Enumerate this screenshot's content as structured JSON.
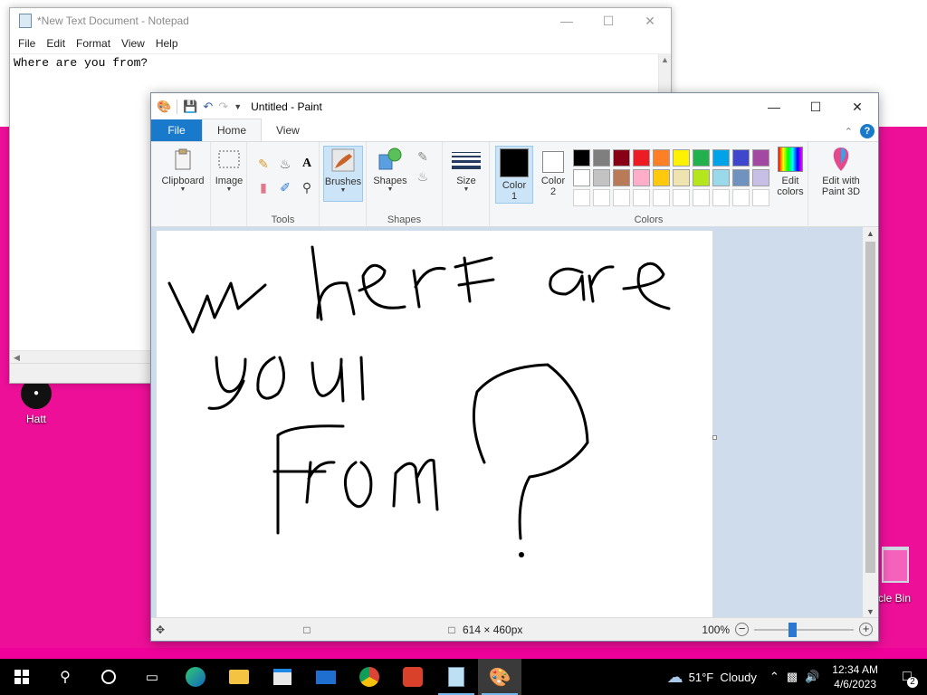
{
  "desktop": {
    "icons": [
      {
        "label": "Hatt"
      },
      {
        "label": "cle Bin"
      }
    ]
  },
  "notepad": {
    "title": "*New Text Document - Notepad",
    "menu": [
      "File",
      "Edit",
      "Format",
      "View",
      "Help"
    ],
    "content": "Where are you from?"
  },
  "paint": {
    "title": "Untitled - Paint",
    "tabs": {
      "file": "File",
      "home": "Home",
      "view": "View"
    },
    "ribbon": {
      "clipboard": "Clipboard",
      "image": "Image",
      "tools": "Tools",
      "brushes": "Brushes",
      "shapes": "Shapes",
      "shapes_group": "Shapes",
      "size": "Size",
      "color1": "Color\n1",
      "color1_a": "Color",
      "color1_b": "1",
      "color2_a": "Color",
      "color2_b": "2",
      "colors": "Colors",
      "edit_colors_a": "Edit",
      "edit_colors_b": "colors",
      "paint3d_a": "Edit with",
      "paint3d_b": "Paint 3D"
    },
    "palette_row1": [
      "#000000",
      "#7f7f7f",
      "#880015",
      "#ed1c24",
      "#ff7f27",
      "#fff200",
      "#22b14c",
      "#00a2e8",
      "#3f48cc",
      "#a349a4"
    ],
    "palette_row2": [
      "#ffffff",
      "#c3c3c3",
      "#b97a57",
      "#ffaec9",
      "#ffc90e",
      "#efe4b0",
      "#b5e61d",
      "#99d9ea",
      "#7092be",
      "#c8bfe7"
    ],
    "color1": "#000000",
    "color2": "#ffffff",
    "canvas_size": "614 × 460px",
    "zoom": "100%"
  },
  "taskbar": {
    "weather": "51°F  Cloudy",
    "time": "12:34 AM",
    "date": "4/6/2023",
    "notifications": "2"
  }
}
